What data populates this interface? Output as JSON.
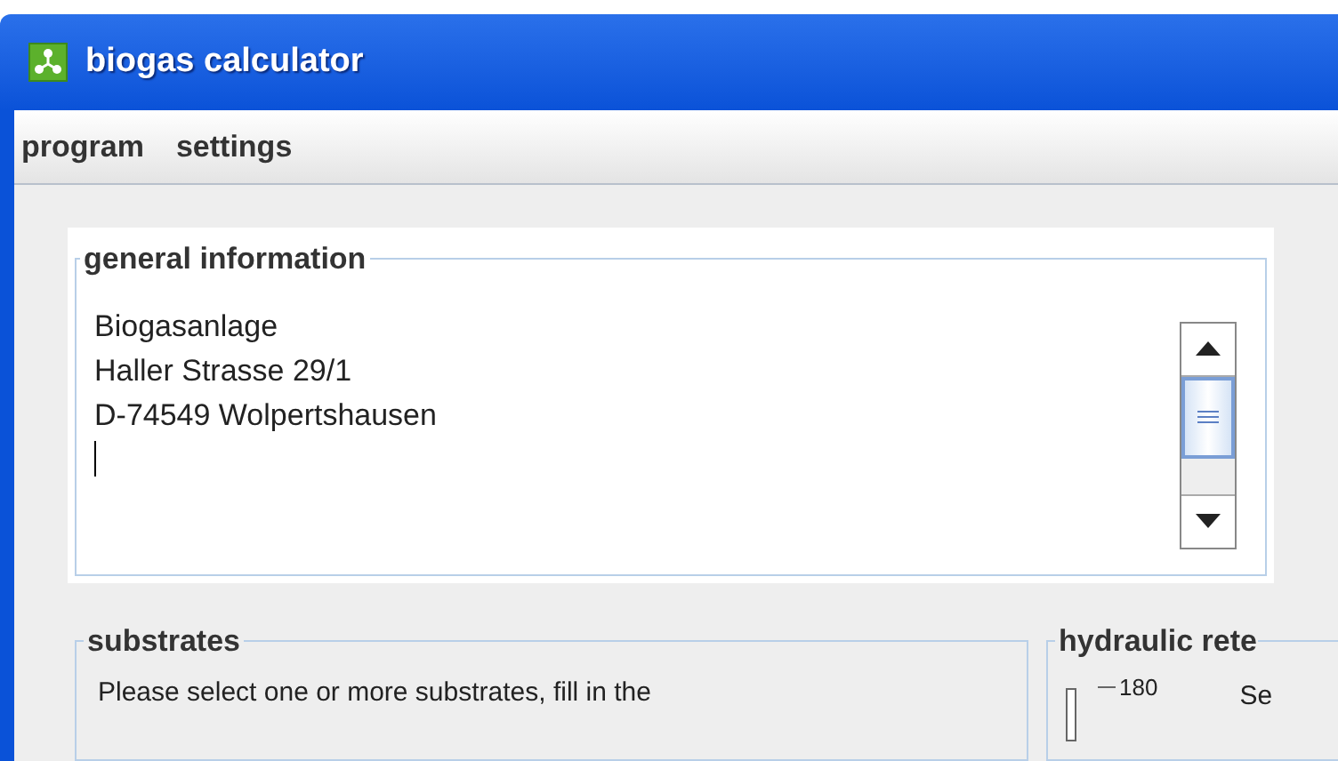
{
  "window": {
    "title": "biogas calculator"
  },
  "menu": [
    {
      "label": "program"
    },
    {
      "label": "settings"
    }
  ],
  "general_information": {
    "title": "general information",
    "lines": [
      "Biogasanlage",
      "Haller Strasse 29/1",
      "D-74549 Wolpertshausen"
    ]
  },
  "substrates": {
    "title": "substrates",
    "text": "Please select one or more substrates, fill in the"
  },
  "hydraulic_retention": {
    "title": "hydraulic rete",
    "tick": "180",
    "text": "Se"
  }
}
